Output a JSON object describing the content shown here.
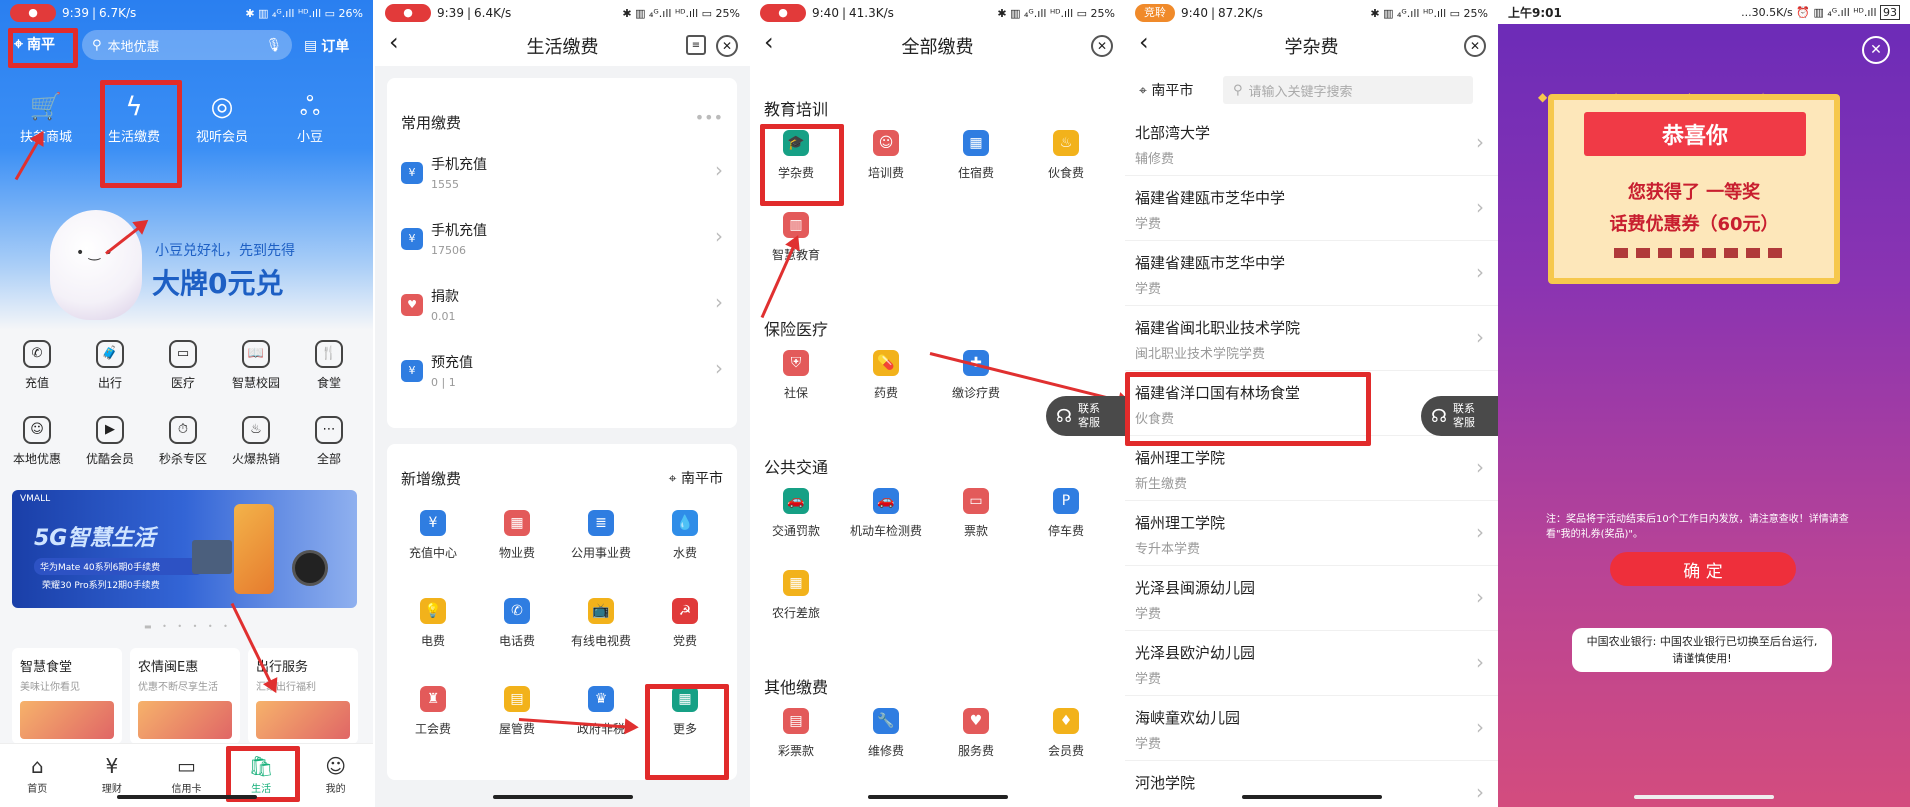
{
  "screen1": {
    "status": {
      "time": "9:39",
      "speed": "6.7K/s",
      "battery": "26"
    },
    "location": "南平",
    "search_placeholder": "本地优惠",
    "orders_label": "订单",
    "top_icons": [
      {
        "label": "扶贫商城",
        "icon": "cart-icon"
      },
      {
        "label": "生活缴费",
        "icon": "lightning-icon"
      },
      {
        "label": "视听会员",
        "icon": "film-reel-icon"
      },
      {
        "label": "小豆",
        "icon": "bean-icon"
      }
    ],
    "banner": {
      "line1": "小豆兑好礼，先到先得",
      "line2": "大牌0元兑"
    },
    "grid": [
      {
        "label": "充值",
        "icon": "phone-icon"
      },
      {
        "label": "出行",
        "icon": "luggage-icon"
      },
      {
        "label": "医疗",
        "icon": "monitor-icon"
      },
      {
        "label": "智慧校园",
        "icon": "book-icon"
      },
      {
        "label": "食堂",
        "icon": "utensils-icon"
      },
      {
        "label": "本地优惠",
        "icon": "person-icon"
      },
      {
        "label": "优酷会员",
        "icon": "video-icon"
      },
      {
        "label": "秒杀专区",
        "icon": "timer-icon"
      },
      {
        "label": "火爆热销",
        "icon": "hot-icon"
      },
      {
        "label": "全部",
        "icon": "more-icon"
      }
    ],
    "promo": {
      "brand": "VMALL",
      "title": "5G智慧生活",
      "sub1": "华为Mate 40系列6期0手续费",
      "sub2": "荣耀30 Pro系列12期0手续费"
    },
    "cards": [
      {
        "title": "智慧食堂",
        "sub": "美味让你看见"
      },
      {
        "title": "农情闽E惠",
        "sub": "优惠不断尽享生活"
      },
      {
        "title": "出行服务",
        "sub": "汇聚出行福利"
      }
    ],
    "nav": [
      "首页",
      "理财",
      "信用卡",
      "生活",
      "我的"
    ]
  },
  "screen2": {
    "status": {
      "time": "9:39",
      "speed": "6.4K/s",
      "battery": "25"
    },
    "title": "生活缴费",
    "common_title": "常用缴费",
    "common": [
      {
        "name": "手机充值",
        "sub": "1555"
      },
      {
        "name": "手机充值",
        "sub": "17506"
      },
      {
        "name": "捐款",
        "sub": "0.01"
      },
      {
        "name": "预充值",
        "sub": "0 | 1"
      }
    ],
    "new_title": "新增缴费",
    "city": "南平市",
    "items": [
      {
        "label": "充值中心",
        "icon": "money-bag-icon",
        "color": "#2f7de1"
      },
      {
        "label": "物业费",
        "icon": "building-icon",
        "color": "#e35a5a"
      },
      {
        "label": "公用事业费",
        "icon": "document-icon",
        "color": "#2f7de1"
      },
      {
        "label": "水费",
        "icon": "water-drop-icon",
        "color": "#2f8de8"
      },
      {
        "label": "电费",
        "icon": "bulb-icon",
        "color": "#f2b21b"
      },
      {
        "label": "电话费",
        "icon": "phone-icon",
        "color": "#2f7de1"
      },
      {
        "label": "有线电视费",
        "icon": "tv-icon",
        "color": "#f2b21b"
      },
      {
        "label": "党费",
        "icon": "party-icon",
        "color": "#e03a3a"
      },
      {
        "label": "工会费",
        "icon": "union-icon",
        "color": "#e35a5a"
      },
      {
        "label": "屋管费",
        "icon": "folder-icon",
        "color": "#f2b21b"
      },
      {
        "label": "政府非税",
        "icon": "gov-icon",
        "color": "#2f7de1"
      },
      {
        "label": "更多",
        "icon": "grid-icon",
        "color": "#16a085"
      }
    ]
  },
  "screen3": {
    "status": {
      "time": "9:40",
      "speed": "41.3K/s",
      "battery": "25"
    },
    "title": "全部缴费",
    "sections": [
      {
        "title": "教育培训",
        "items": [
          {
            "label": "学杂费",
            "icon": "graduation-cap-icon",
            "color": "#16a085"
          },
          {
            "label": "培训费",
            "icon": "person-icon",
            "color": "#e35a5a"
          },
          {
            "label": "住宿费",
            "icon": "building-icon",
            "color": "#2f7de1"
          },
          {
            "label": "伙食费",
            "icon": "chef-hat-icon",
            "color": "#f2b21b"
          },
          {
            "label": "智慧教育",
            "icon": "school-icon",
            "color": "#e35a5a"
          }
        ]
      },
      {
        "title": "保险医疗",
        "items": [
          {
            "label": "社保",
            "icon": "shield-icon",
            "color": "#e35a5a"
          },
          {
            "label": "药费",
            "icon": "pill-icon",
            "color": "#f2b21b"
          },
          {
            "label": "缴诊疗费",
            "icon": "hospital-icon",
            "color": "#2f7de1"
          }
        ]
      },
      {
        "title": "公共交通",
        "items": [
          {
            "label": "交通罚款",
            "icon": "car-icon",
            "color": "#16a085"
          },
          {
            "label": "机动车检测费",
            "icon": "car-icon",
            "color": "#2f7de1"
          },
          {
            "label": "票款",
            "icon": "ticket-icon",
            "color": "#e35a5a"
          },
          {
            "label": "停车费",
            "icon": "parking-icon",
            "color": "#2f7de1"
          },
          {
            "label": "农行差旅",
            "icon": "calendar-icon",
            "color": "#f2b21b"
          }
        ]
      },
      {
        "title": "其他缴费",
        "items": [
          {
            "label": "彩票款",
            "icon": "lottery-icon",
            "color": "#e35a5a"
          },
          {
            "label": "维修费",
            "icon": "wrench-icon",
            "color": "#2f7de1"
          },
          {
            "label": "服务费",
            "icon": "hand-heart-icon",
            "color": "#e35a5a"
          },
          {
            "label": "会员费",
            "icon": "vip-icon",
            "color": "#f2b21b"
          }
        ]
      }
    ],
    "service": "联系客服"
  },
  "screen4": {
    "status": {
      "time": "9:40",
      "speed": "87.2K/s",
      "battery": "25",
      "badge": "竞聆"
    },
    "title": "学杂费",
    "city": "南平市",
    "search_placeholder": "请输入关键字搜索",
    "list": [
      {
        "name": "北部湾大学",
        "sub": "辅修费"
      },
      {
        "name": "福建省建瓯市芝华中学",
        "sub": "学费"
      },
      {
        "name": "福建省建瓯市芝华中学",
        "sub": "学费"
      },
      {
        "name": "福建省闽北职业技术学院",
        "sub": "闽北职业技术学院学费"
      },
      {
        "name": "福建省洋口国有林场食堂",
        "sub": "伙食费"
      },
      {
        "name": "福州理工学院",
        "sub": "新生缴费"
      },
      {
        "name": "福州理工学院",
        "sub": "专升本学费"
      },
      {
        "name": "光泽县闽源幼儿园",
        "sub": "学费"
      },
      {
        "name": "光泽县欧沪幼儿园",
        "sub": "学费"
      },
      {
        "name": "海峡童欢幼儿园",
        "sub": "学费"
      },
      {
        "name": "河池学院",
        "sub": ""
      }
    ],
    "service": "联系客服"
  },
  "screen5": {
    "status": {
      "time": "上午9:01",
      "speed": "...30.5K/s",
      "battery": "93"
    },
    "congrats": "恭喜你",
    "prize_line1a": "您获得了",
    "prize_line1b": "一等奖",
    "prize_line2": "话费优惠券（60元）",
    "note": "注：奖品将于活动结束后10个工作日内发放，请注意查收！详情请查看\"我的礼券(奖品)\"。",
    "confirm": "确 定",
    "toast": "中国农业银行: 中国农业银行已切换至后台运行,请谨慎使用!"
  }
}
